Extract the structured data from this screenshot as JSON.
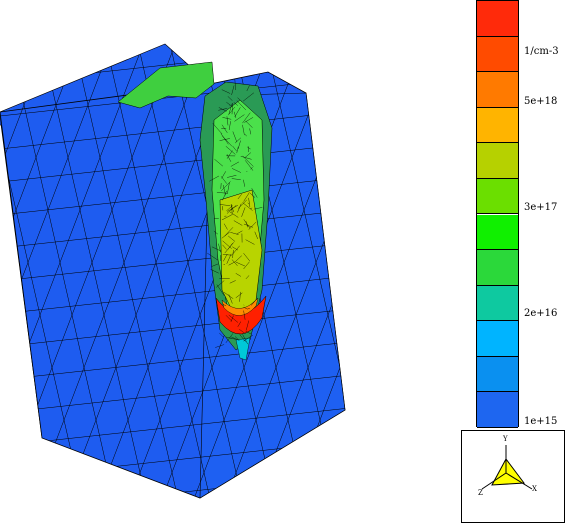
{
  "legend": {
    "unit_label": "1/cm-3",
    "tick_labels": [
      "5e+18",
      "3e+17",
      "2e+16",
      "1e+15"
    ],
    "colors": [
      "#ff2a0a",
      "#ff4b00",
      "#ff7a00",
      "#ffb400",
      "#b6d100",
      "#6bdf00",
      "#10f000",
      "#2bd83a",
      "#0ec9a0",
      "#00b4ff",
      "#0a90f0",
      "#1e66f0"
    ]
  },
  "orientation": {
    "x_label": "X",
    "y_label": "Y",
    "z_label": "Z",
    "triangle_color": "#ffff00"
  },
  "model": {
    "base_color": "#1e5cf0",
    "hot_color": "#ff2000",
    "mesh_line_color": "#000000"
  }
}
